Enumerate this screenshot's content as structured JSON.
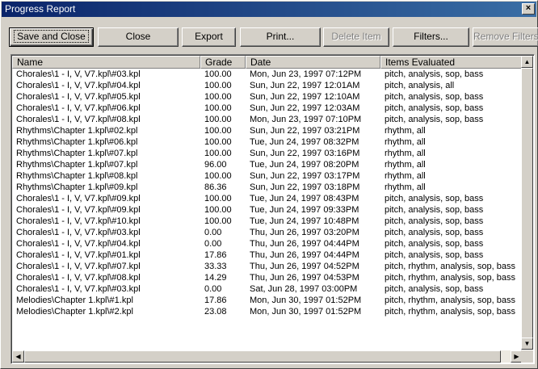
{
  "window": {
    "title": "Progress Report",
    "close_glyph": "×"
  },
  "toolbar": {
    "buttons": [
      {
        "label": "Save and Close",
        "enabled": true,
        "default": true
      },
      {
        "label": "Close",
        "enabled": true
      },
      {
        "label": "Export",
        "enabled": true
      },
      {
        "label": "Print...",
        "enabled": true
      },
      {
        "label": "Delete Item",
        "enabled": false
      },
      {
        "label": "Filters...",
        "enabled": true
      },
      {
        "label": "Remove Filters",
        "enabled": false
      }
    ]
  },
  "table": {
    "columns": [
      "Name",
      "Grade",
      "Date",
      "Items Evaluated"
    ],
    "rows": [
      [
        "Chorales\\1 - I, V, V7.kpl\\#03.kpl",
        "100.00",
        "Mon, Jun 23, 1997 07:12PM",
        "pitch, analysis, sop, bass"
      ],
      [
        "Chorales\\1 - I, V, V7.kpl\\#04.kpl",
        "100.00",
        "Sun, Jun 22, 1997 12:01AM",
        "pitch, analysis, all"
      ],
      [
        "Chorales\\1 - I, V, V7.kpl\\#05.kpl",
        "100.00",
        "Sun, Jun 22, 1997 12:10AM",
        "pitch, analysis, sop, bass"
      ],
      [
        "Chorales\\1 - I, V, V7.kpl\\#06.kpl",
        "100.00",
        "Sun, Jun 22, 1997 12:03AM",
        "pitch, analysis, sop, bass"
      ],
      [
        "Chorales\\1 - I, V, V7.kpl\\#08.kpl",
        "100.00",
        "Mon, Jun 23, 1997 07:10PM",
        "pitch, analysis, sop, bass"
      ],
      [
        "Rhythms\\Chapter 1.kpl\\#02.kpl",
        "100.00",
        "Sun, Jun 22, 1997 03:21PM",
        "rhythm, all"
      ],
      [
        "Rhythms\\Chapter 1.kpl\\#06.kpl",
        "100.00",
        "Tue, Jun 24, 1997 08:32PM",
        "rhythm, all"
      ],
      [
        "Rhythms\\Chapter 1.kpl\\#07.kpl",
        "100.00",
        "Sun, Jun 22, 1997 03:16PM",
        "rhythm, all"
      ],
      [
        "Rhythms\\Chapter 1.kpl\\#07.kpl",
        "96.00",
        "Tue, Jun 24, 1997 08:20PM",
        "rhythm, all"
      ],
      [
        "Rhythms\\Chapter 1.kpl\\#08.kpl",
        "100.00",
        "Sun, Jun 22, 1997 03:17PM",
        "rhythm, all"
      ],
      [
        "Rhythms\\Chapter 1.kpl\\#09.kpl",
        "86.36",
        "Sun, Jun 22, 1997 03:18PM",
        "rhythm, all"
      ],
      [
        "Chorales\\1 - I, V, V7.kpl\\#09.kpl",
        "100.00",
        "Tue, Jun 24, 1997 08:43PM",
        "pitch, analysis, sop, bass"
      ],
      [
        "Chorales\\1 - I, V, V7.kpl\\#09.kpl",
        "100.00",
        "Tue, Jun 24, 1997 09:33PM",
        "pitch, analysis, sop, bass"
      ],
      [
        "Chorales\\1 - I, V, V7.kpl\\#10.kpl",
        "100.00",
        "Tue, Jun 24, 1997 10:48PM",
        "pitch, analysis, sop, bass"
      ],
      [
        "Chorales\\1 - I, V, V7.kpl\\#03.kpl",
        "0.00",
        "Thu, Jun 26, 1997 03:20PM",
        "pitch, analysis, sop, bass"
      ],
      [
        "Chorales\\1 - I, V, V7.kpl\\#04.kpl",
        "0.00",
        "Thu, Jun 26, 1997 04:44PM",
        "pitch, analysis, sop, bass"
      ],
      [
        "Chorales\\1 - I, V, V7.kpl\\#01.kpl",
        "17.86",
        "Thu, Jun 26, 1997 04:44PM",
        "pitch, analysis, sop, bass"
      ],
      [
        "Chorales\\1 - I, V, V7.kpl\\#07.kpl",
        "33.33",
        "Thu, Jun 26, 1997 04:52PM",
        "pitch, rhythm, analysis, sop, bass"
      ],
      [
        "Chorales\\1 - I, V, V7.kpl\\#08.kpl",
        "14.29",
        "Thu, Jun 26, 1997 04:53PM",
        "pitch, rhythm, analysis, sop, bass"
      ],
      [
        "Chorales\\1 - I, V, V7.kpl\\#03.kpl",
        "0.00",
        "Sat, Jun 28, 1997 03:00PM",
        "pitch, analysis, sop, bass"
      ],
      [
        "Melodies\\Chapter 1.kpl\\#1.kpl",
        "17.86",
        "Mon, Jun 30, 1997 01:52PM",
        "pitch, rhythm, analysis, sop, bass"
      ],
      [
        "Melodies\\Chapter 1.kpl\\#2.kpl",
        "23.08",
        "Mon, Jun 30, 1997 01:52PM",
        "pitch, rhythm, analysis, sop, bass"
      ]
    ]
  },
  "scrollbars": {
    "up_glyph": "▲",
    "down_glyph": "▼",
    "left_glyph": "◀",
    "right_glyph": "▶"
  }
}
